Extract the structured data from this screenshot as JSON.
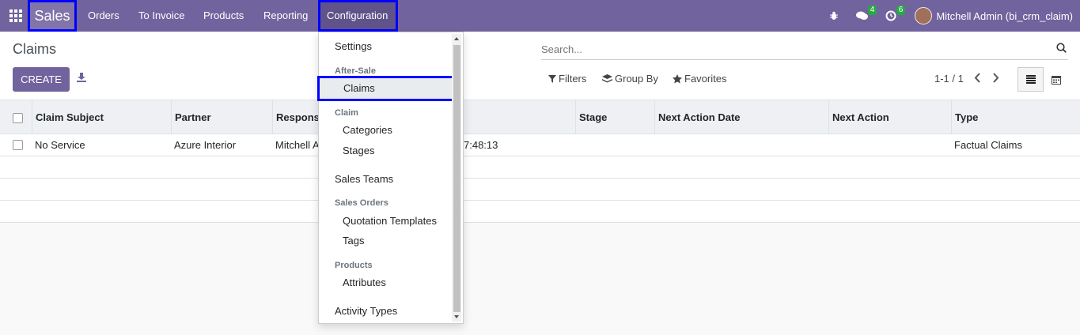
{
  "navbar": {
    "brand": "Sales",
    "menu": [
      "Orders",
      "To Invoice",
      "Products",
      "Reporting",
      "Configuration"
    ],
    "messages_count": "4",
    "activities_count": "6",
    "user": "Mitchell Admin (bi_crm_claim)"
  },
  "control_panel": {
    "title": "Claims",
    "create_label": "CREATE",
    "search_placeholder": "Search...",
    "filters_label": "Filters",
    "group_by_label": "Group By",
    "favorites_label": "Favorites",
    "pager": "1-1 / 1"
  },
  "table": {
    "columns": [
      "Claim Subject",
      "Partner",
      "Respons",
      "Stage",
      "Next Action Date",
      "Next Action",
      "Type"
    ],
    "rows": [
      {
        "subject": "No Service",
        "partner": "Azure Interior",
        "responsible": "Mitchell A",
        "date": "7:48:13",
        "type": "Factual Claims"
      }
    ]
  },
  "dropdown": {
    "settings": "Settings",
    "after_sale_header": "After-Sale",
    "claims": "Claims",
    "claim_header": "Claim",
    "categories": "Categories",
    "stages": "Stages",
    "sales_teams": "Sales Teams",
    "sales_orders_header": "Sales Orders",
    "quotation_templates": "Quotation Templates",
    "tags": "Tags",
    "products_header": "Products",
    "attributes": "Attributes",
    "activity_types": "Activity Types"
  },
  "colors": {
    "brand": "#71639e",
    "highlight_border": "#0000ff",
    "badge": "#28a745"
  }
}
